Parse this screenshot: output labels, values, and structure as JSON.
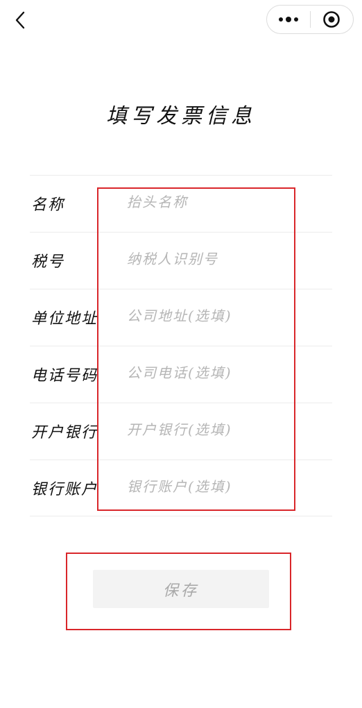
{
  "nav": {
    "back_icon": "chevron-left-icon",
    "more_icon": "more-dots-icon",
    "close_icon": "target-circle-icon"
  },
  "page": {
    "title": "填写发票信息"
  },
  "form": {
    "fields": [
      {
        "label": "名称",
        "placeholder": "抬头名称",
        "value": ""
      },
      {
        "label": "税号",
        "placeholder": "纳税人识别号",
        "value": ""
      },
      {
        "label": "单位地址",
        "placeholder": "公司地址(选填)",
        "value": ""
      },
      {
        "label": "电话号码",
        "placeholder": "公司电话(选填)",
        "value": ""
      },
      {
        "label": "开户银行",
        "placeholder": "开户银行(选填)",
        "value": ""
      },
      {
        "label": "银行账户",
        "placeholder": "银行账户(选填)",
        "value": ""
      }
    ]
  },
  "actions": {
    "save_label": "保存"
  },
  "colors": {
    "highlight": "#d9262a",
    "button_bg": "#f3f3f3",
    "placeholder": "#b5b5b5"
  }
}
